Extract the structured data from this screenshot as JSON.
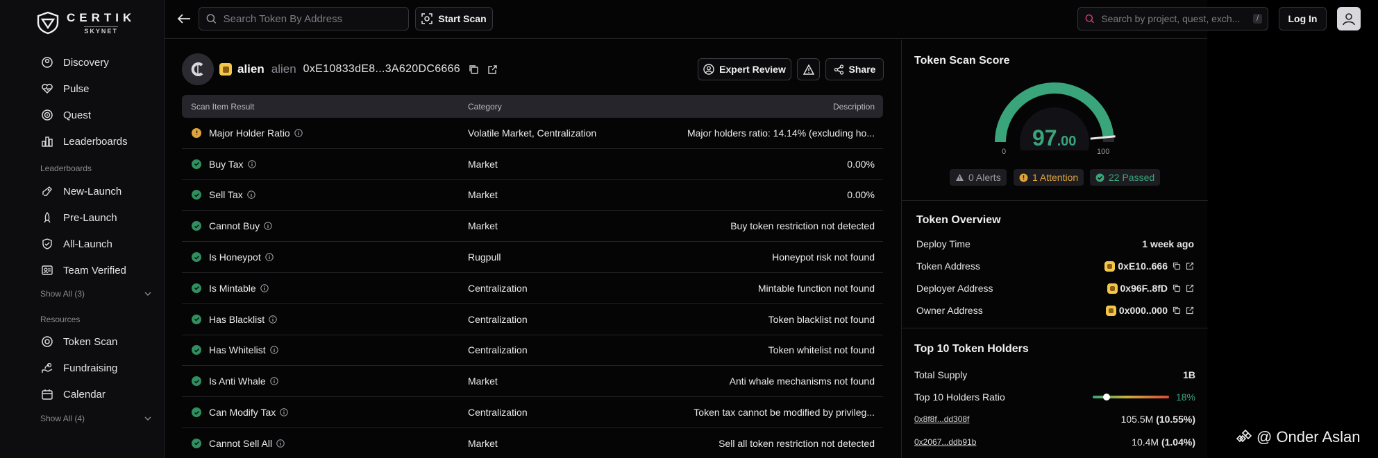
{
  "brand": {
    "title": "CERTIK",
    "subtitle": "SKYNET"
  },
  "sidebar": {
    "main_items": [
      {
        "label": "Discovery",
        "icon": "discovery-icon"
      },
      {
        "label": "Pulse",
        "icon": "pulse-icon"
      },
      {
        "label": "Quest",
        "icon": "quest-icon"
      },
      {
        "label": "Leaderboards",
        "icon": "leaderboards-icon"
      }
    ],
    "leaderboards_section": "Leaderboards",
    "leaderboard_items": [
      {
        "label": "New-Launch",
        "icon": "new-launch-icon"
      },
      {
        "label": "Pre-Launch",
        "icon": "pre-launch-icon"
      },
      {
        "label": "All-Launch",
        "icon": "all-launch-icon"
      },
      {
        "label": "Team Verified",
        "icon": "team-verified-icon"
      }
    ],
    "show_all_1": "Show All (3)",
    "resources_section": "Resources",
    "resource_items": [
      {
        "label": "Token Scan",
        "icon": "token-scan-icon"
      },
      {
        "label": "Fundraising",
        "icon": "fundraising-icon"
      },
      {
        "label": "Calendar",
        "icon": "calendar-icon"
      }
    ],
    "show_all_2": "Show All (4)"
  },
  "topbar": {
    "token_search_placeholder": "Search Token By Address",
    "start_scan": "Start Scan",
    "project_search_placeholder": "Search by project, quest, exch...",
    "shortcut": "/",
    "login": "Log In"
  },
  "token": {
    "symbol": "alien",
    "name": "alien",
    "address": "0xE10833dE8...3A620DC6666",
    "expert_review": "Expert Review",
    "share": "Share"
  },
  "table": {
    "headers": [
      "Scan Item Result",
      "Category",
      "Description"
    ],
    "rows": [
      {
        "status": "warn",
        "item": "Major Holder Ratio",
        "category": "Volatile Market, Centralization",
        "description": "Major holders ratio: 14.14% (excluding ho..."
      },
      {
        "status": "ok",
        "item": "Buy Tax",
        "category": "Market",
        "description": "0.00%"
      },
      {
        "status": "ok",
        "item": "Sell Tax",
        "category": "Market",
        "description": "0.00%"
      },
      {
        "status": "ok",
        "item": "Cannot Buy",
        "category": "Market",
        "description": "Buy token restriction not detected"
      },
      {
        "status": "ok",
        "item": "Is Honeypot",
        "category": "Rugpull",
        "description": "Honeypot risk not found"
      },
      {
        "status": "ok",
        "item": "Is Mintable",
        "category": "Centralization",
        "description": "Mintable function not found"
      },
      {
        "status": "ok",
        "item": "Has Blacklist",
        "category": "Centralization",
        "description": "Token blacklist not found"
      },
      {
        "status": "ok",
        "item": "Has Whitelist",
        "category": "Centralization",
        "description": "Token whitelist not found"
      },
      {
        "status": "ok",
        "item": "Is Anti Whale",
        "category": "Market",
        "description": "Anti whale mechanisms not found"
      },
      {
        "status": "ok",
        "item": "Can Modify Tax",
        "category": "Centralization",
        "description": "Token tax cannot be modified by privileg..."
      },
      {
        "status": "ok",
        "item": "Cannot Sell All",
        "category": "Market",
        "description": "Sell all token restriction not detected"
      }
    ]
  },
  "scan_score": {
    "title": "Token Scan Score",
    "score_int": "97",
    "score_dec": ".00",
    "score_value": 97,
    "min_label": "0",
    "max_label": "100",
    "alerts": "0 Alerts",
    "attention": "1 Attention",
    "passed": "22 Passed",
    "colors": {
      "good": "#3aa57a",
      "attention": "#e0a53a",
      "muted": "#9a9aa2"
    }
  },
  "overview": {
    "title": "Token Overview",
    "rows": [
      {
        "label": "Deploy Time",
        "value": "1 week ago"
      },
      {
        "label": "Token Address",
        "value": "0xE10..666"
      },
      {
        "label": "Deployer Address",
        "value": "0x96F..8fD"
      },
      {
        "label": "Owner Address",
        "value": "0x000..000"
      }
    ]
  },
  "holders": {
    "title": "Top 10 Token Holders",
    "total_supply_label": "Total Supply",
    "total_supply": "1B",
    "ratio_label": "Top 10 Holders Ratio",
    "ratio": "18%",
    "ratio_fraction": 0.18,
    "list": [
      {
        "address": "0x8f8f...dd308f",
        "amount": "105.5M",
        "pct": "(10.55%)"
      },
      {
        "address": "0x2067...ddb91b",
        "amount": "10.4M",
        "pct": "(1.04%)"
      }
    ]
  },
  "watermark": "@ Onder Aslan"
}
